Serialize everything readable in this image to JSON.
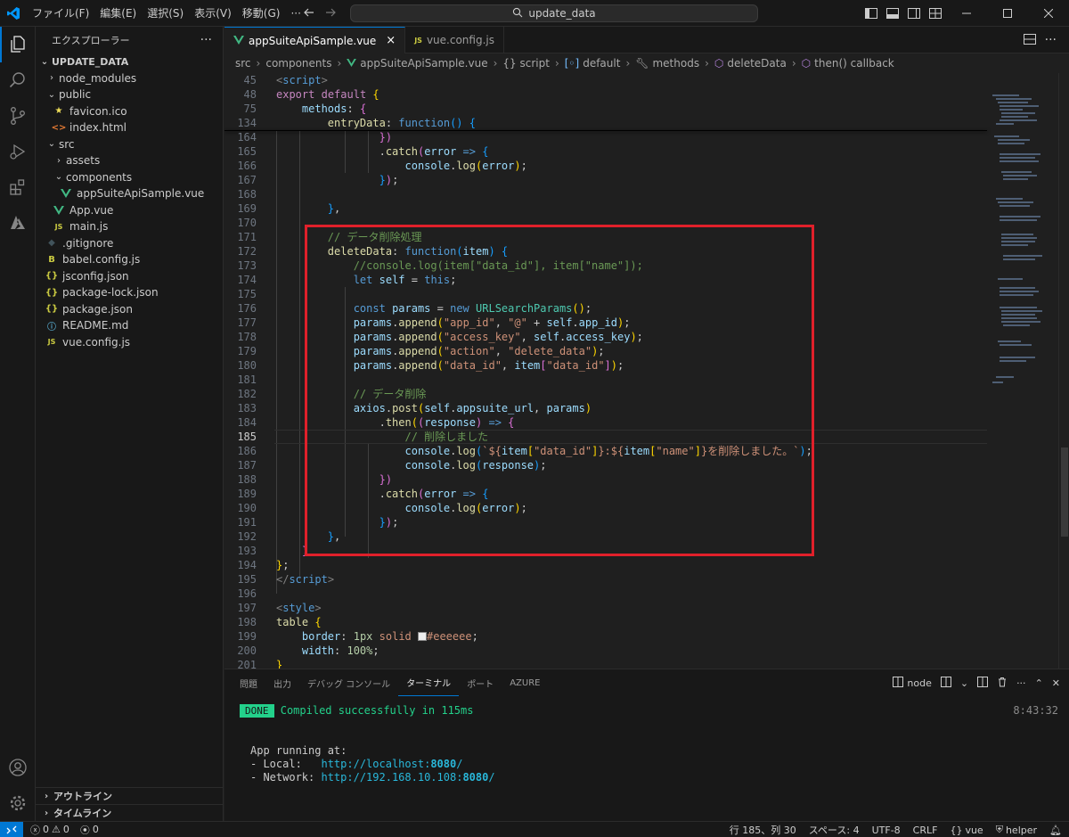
{
  "window": {
    "command_center_text": "update_data"
  },
  "menus": [
    "ファイル(F)",
    "編集(E)",
    "選択(S)",
    "表示(V)",
    "移動(G)",
    "···"
  ],
  "sidebar": {
    "title": "エクスプローラー",
    "more": "···",
    "root": "UPDATE_DATA",
    "items": [
      {
        "label": "node_modules",
        "type": "folder",
        "open": false,
        "depth": 1
      },
      {
        "label": "public",
        "type": "folder",
        "open": true,
        "depth": 1
      },
      {
        "label": "favicon.ico",
        "type": "star",
        "depth": 2
      },
      {
        "label": "index.html",
        "type": "html",
        "depth": 2
      },
      {
        "label": "src",
        "type": "folder",
        "open": true,
        "depth": 1
      },
      {
        "label": "assets",
        "type": "folder",
        "open": false,
        "depth": 2
      },
      {
        "label": "components",
        "type": "folder",
        "open": true,
        "depth": 2
      },
      {
        "label": "appSuiteApiSample.vue",
        "type": "vue",
        "depth": 3
      },
      {
        "label": "App.vue",
        "type": "vue",
        "depth": 2
      },
      {
        "label": "main.js",
        "type": "js",
        "depth": 2
      },
      {
        "label": ".gitignore",
        "type": "git",
        "depth": 1
      },
      {
        "label": "babel.config.js",
        "type": "babel",
        "depth": 1
      },
      {
        "label": "jsconfig.json",
        "type": "json",
        "depth": 1
      },
      {
        "label": "package-lock.json",
        "type": "json",
        "depth": 1
      },
      {
        "label": "package.json",
        "type": "json",
        "depth": 1
      },
      {
        "label": "README.md",
        "type": "info",
        "depth": 1
      },
      {
        "label": "vue.config.js",
        "type": "js",
        "depth": 1
      }
    ],
    "outline": "アウトライン",
    "timeline": "タイムライン"
  },
  "tabs": [
    {
      "label": "appSuiteApiSample.vue",
      "active": true,
      "close": "×"
    },
    {
      "label": "vue.config.js",
      "active": false
    }
  ],
  "breadcrumb": [
    "src",
    "components",
    "appSuiteApiSample.vue",
    "{} script",
    "default",
    "methods",
    "deleteData",
    "then() callback"
  ],
  "panel": {
    "tabs": [
      "問題",
      "出力",
      "デバッグ コンソール",
      "ターミナル",
      "ポート",
      "AZURE"
    ],
    "active_tab": "ターミナル",
    "terminal_name": "node",
    "done": "DONE",
    "compiled": "Compiled successfully in 115ms",
    "time": "8:43:32",
    "app_running": "App running at:",
    "local_label": "- Local:   ",
    "local_url": "http://localhost:",
    "local_port": "8080",
    "network_label": "- Network: ",
    "network_url": "http://192.168.10.108:",
    "network_port": "8080",
    "slash": "/"
  },
  "statusbar": {
    "errors": "0",
    "warnings": "0",
    "ports": "0",
    "position": "行 185、列 30",
    "spaces": "スペース: 4",
    "encoding": "UTF-8",
    "eol": "CRLF",
    "language": "vue",
    "helper": "helper"
  },
  "colors": {
    "accent": "#0078d4",
    "highlight_border": "#e0202a",
    "vue_green": "#41b883",
    "js_yellow": "#cbcb41"
  }
}
